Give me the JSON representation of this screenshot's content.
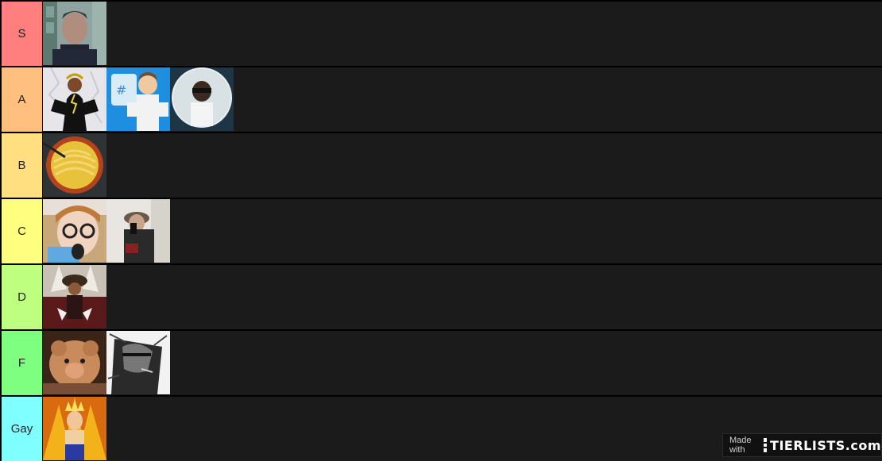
{
  "tiers": [
    {
      "label": "S",
      "color": "#ff7f7f",
      "items": [
        "portrait-in-front-of-building"
      ]
    },
    {
      "label": "A",
      "color": "#ffbf7f",
      "items": [
        "lightning-hero-art",
        "cartoon-character-blue-background",
        "sunglasses-person-circle"
      ]
    },
    {
      "label": "B",
      "color": "#ffdf7f",
      "items": [
        "noodle-bowl"
      ]
    },
    {
      "label": "C",
      "color": "#ffff7f",
      "items": [
        "person-with-glasses-selfie",
        "mirror-selfie-person-with-hat"
      ]
    },
    {
      "label": "D",
      "color": "#bfff7f",
      "items": [
        "anime-character-red-art"
      ]
    },
    {
      "label": "F",
      "color": "#7fff7f",
      "items": [
        "fluffy-calf",
        "manga-soldier-with-cigar"
      ]
    },
    {
      "label": "Gay",
      "color": "#7fffff",
      "items": [
        "super-saiyan-anime-art"
      ]
    }
  ],
  "watermark": {
    "made_with": "Made with",
    "brand": "TIERLISTS.com"
  }
}
